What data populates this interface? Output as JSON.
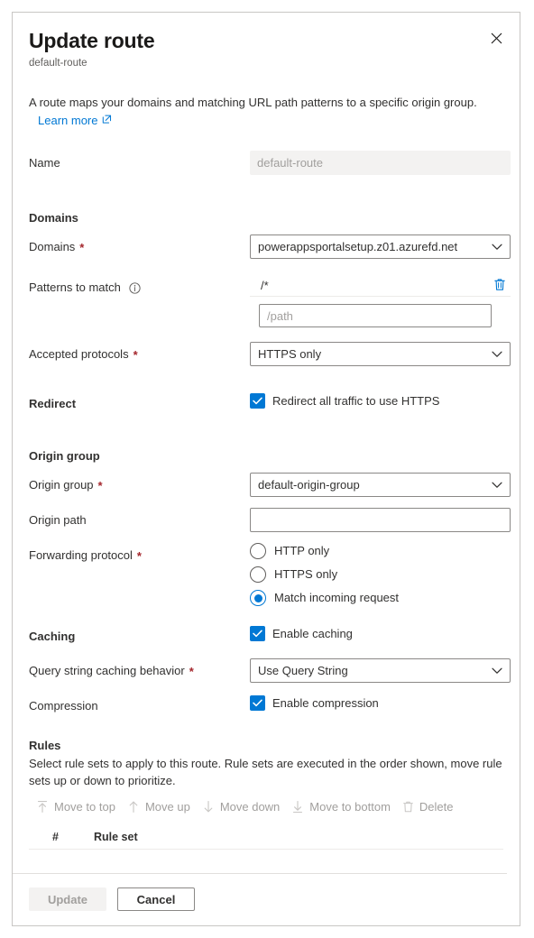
{
  "dialog": {
    "title": "Update route",
    "subtitle": "default-route",
    "close_label": "Close",
    "description": "A route maps your domains and matching URL path patterns to a specific origin group.",
    "learn_more": "Learn more"
  },
  "name_field": {
    "label": "Name",
    "value": "default-route"
  },
  "domains_section": {
    "heading": "Domains",
    "domains_label": "Domains",
    "domains_value": "powerappsportalsetup.z01.azurefd.net",
    "patterns_label": "Patterns to match",
    "patterns": [
      {
        "value": "/*"
      }
    ],
    "pattern_placeholder": "/path",
    "pattern_input_value": "",
    "accepted_protocols_label": "Accepted protocols",
    "accepted_protocols_value": "HTTPS only"
  },
  "redirect_section": {
    "label": "Redirect",
    "checkbox_label": "Redirect all traffic to use HTTPS",
    "checked": true
  },
  "origin_section": {
    "heading": "Origin group",
    "origin_group_label": "Origin group",
    "origin_group_value": "default-origin-group",
    "origin_path_label": "Origin path",
    "origin_path_value": "",
    "forwarding_label": "Forwarding protocol",
    "forwarding_options": [
      {
        "label": "HTTP only",
        "selected": false
      },
      {
        "label": "HTTPS only",
        "selected": false
      },
      {
        "label": "Match incoming request",
        "selected": true
      }
    ]
  },
  "caching_section": {
    "label": "Caching",
    "enable_caching_label": "Enable caching",
    "enable_caching_checked": true,
    "query_string_label": "Query string caching behavior",
    "query_string_value": "Use Query String",
    "compression_label": "Compression",
    "enable_compression_label": "Enable compression",
    "enable_compression_checked": true
  },
  "rules_section": {
    "heading": "Rules",
    "description": "Select rule sets to apply to this route. Rule sets are executed in the order shown, move rule sets up or down to prioritize.",
    "toolbar": [
      {
        "label": "Move to top",
        "icon": "arrow-up-to-line-icon"
      },
      {
        "label": "Move up",
        "icon": "arrow-up-icon"
      },
      {
        "label": "Move down",
        "icon": "arrow-down-icon"
      },
      {
        "label": "Move to bottom",
        "icon": "arrow-down-to-line-icon"
      },
      {
        "label": "Delete",
        "icon": "trash-icon"
      }
    ],
    "columns": {
      "number": "#",
      "rule_set": "Rule set"
    },
    "rows": []
  },
  "footer": {
    "update_label": "Update",
    "cancel_label": "Cancel"
  },
  "colors": {
    "accent": "#0078D4",
    "required_asterisk": "#A4262C",
    "link": "#0078D4",
    "disabled_text": "#A19F9D",
    "border": "#8A8886"
  }
}
